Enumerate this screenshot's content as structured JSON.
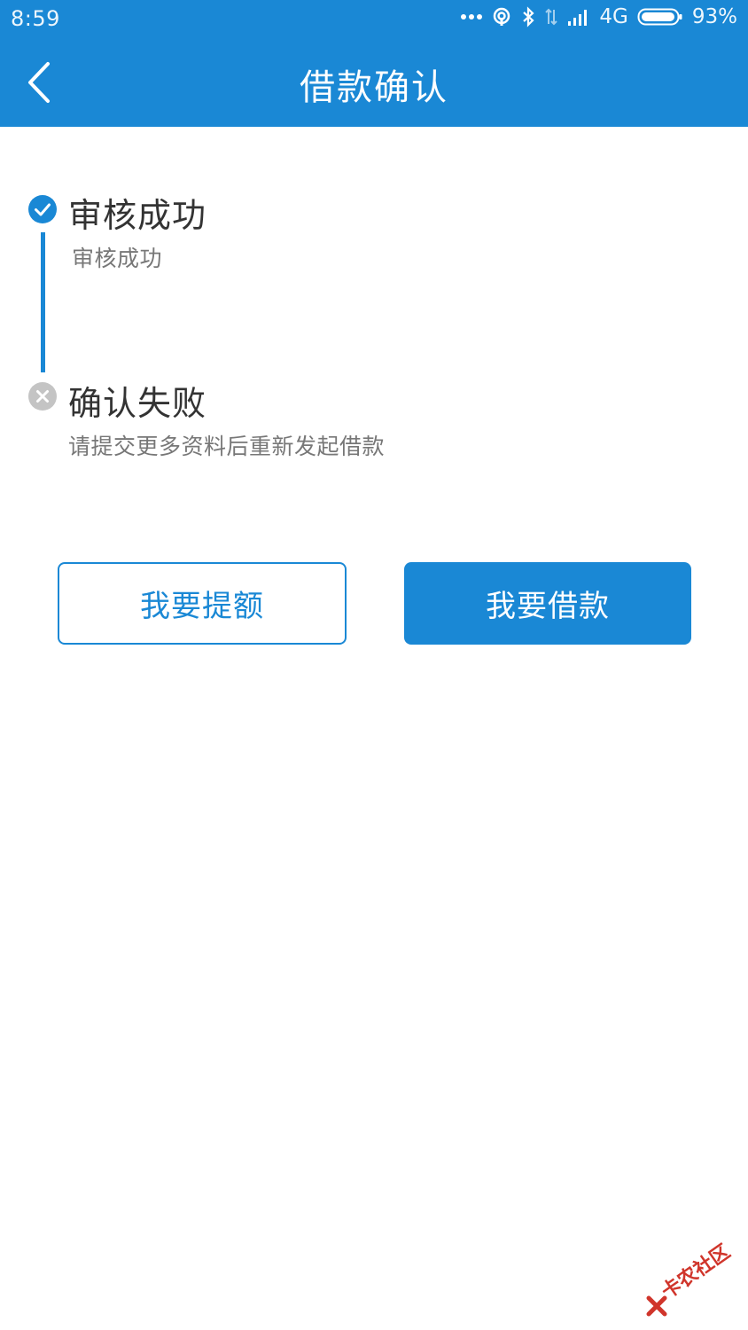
{
  "status_bar": {
    "time": "8:59",
    "network": "4G",
    "battery": "93%"
  },
  "nav": {
    "title": "借款确认"
  },
  "steps": [
    {
      "title": "审核成功",
      "desc": "审核成功",
      "status": "success"
    },
    {
      "title": "确认失败",
      "desc": "请提交更多资料后重新发起借款",
      "status": "failed"
    }
  ],
  "actions": {
    "raise_limit": "我要提额",
    "borrow": "我要借款"
  },
  "watermark": {
    "text": "卡农社区"
  },
  "colors": {
    "primary": "#1a88d5",
    "failed_icon": "#c4c4c4",
    "watermark": "#d0352b"
  }
}
